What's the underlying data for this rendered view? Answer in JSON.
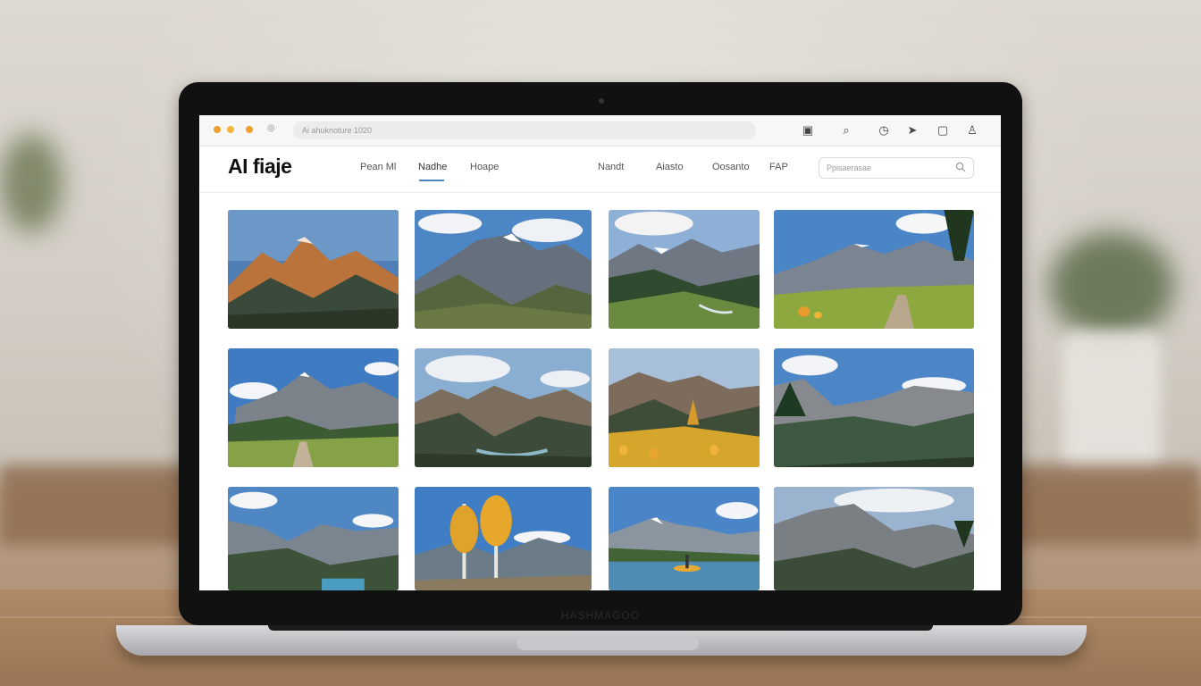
{
  "browser": {
    "url": "Ai ahuknoture 1020"
  },
  "site": {
    "logo": "AI fiaje",
    "nav_left": [
      "Pean Ml",
      "Nadhe",
      "Hoape"
    ],
    "nav_right": [
      "Nandt",
      "Aiasto",
      "Oosanto",
      "FAP"
    ],
    "active_nav": "Nadhe",
    "search_placeholder": "Ppisaerasae"
  },
  "laptop": {
    "brand": "HASHMAGOO"
  },
  "gallery": {
    "tiles": [
      {
        "theme": "sunlit-peaks"
      },
      {
        "theme": "cloudy-ridge"
      },
      {
        "theme": "alpine-meadow"
      },
      {
        "theme": "wildflower-trail"
      },
      {
        "theme": "meadow-path"
      },
      {
        "theme": "river-valley"
      },
      {
        "theme": "golden-slope"
      },
      {
        "theme": "pine-valley"
      },
      {
        "theme": "lake-valley"
      },
      {
        "theme": "autumn-aspens"
      },
      {
        "theme": "lake-boat"
      },
      {
        "theme": "rocky-peaks"
      }
    ]
  },
  "icons": {
    "toolbar": [
      "share-icon",
      "search-icon",
      "clock-icon",
      "send-icon",
      "window-icon",
      "user-icon"
    ]
  },
  "colors": {
    "accent": "#4a86c5",
    "traffic_orange": "#f0a02e"
  }
}
